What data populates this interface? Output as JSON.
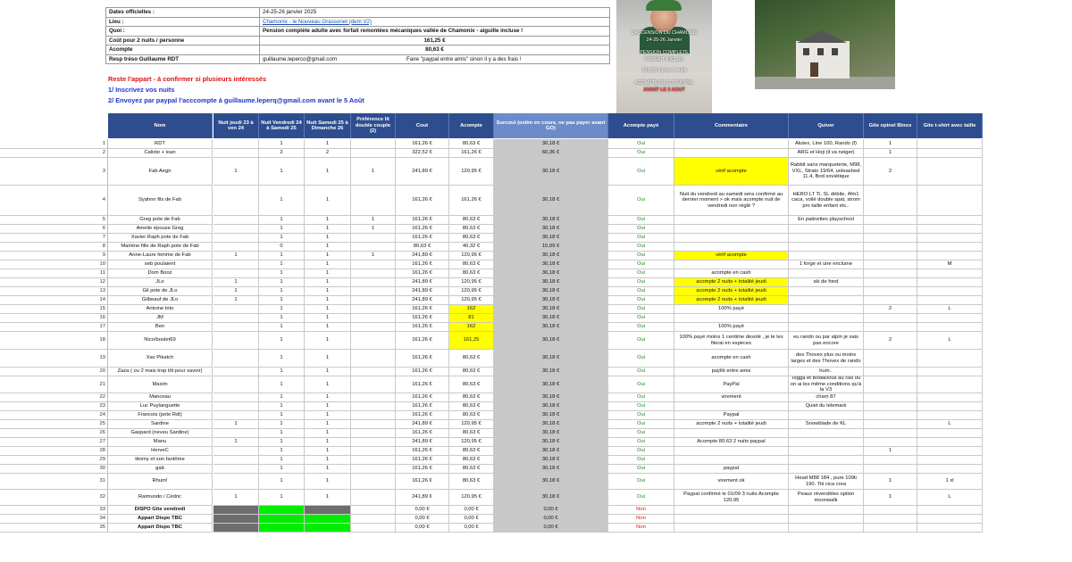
{
  "info": [
    {
      "key": "Dates officielles :",
      "value": "24-25-26 janvier 2025",
      "link": false
    },
    {
      "key": "Lieu :",
      "value": "Chamonix - le Nouveau Grassonet (dem V2)",
      "link": true
    },
    {
      "key": "Quoi :",
      "value": "Pension complète adulte avec forfait remontées mécaniques vallée de Chamonix - aiguille incluse !",
      "bold": true
    },
    {
      "key": "Coût pour 2 nuits / personne",
      "value": "161,25 €",
      "bold": true,
      "center": true
    },
    {
      "key": "Acompte",
      "value": "80,63 €",
      "bold": true,
      "center": true
    },
    {
      "key": "Resp tréso Guillaume RDT",
      "value": "guillaume.leperco@gmail.com",
      "extra": "Faire \"paypal entre amis\" sinon il y a des frais !"
    }
  ],
  "notes": [
    "Reste l'appart - à confirmer si plusieurs intéressés",
    "1/ Inscrivez vos nuits",
    "2/ Envoyez par paypal l'acccompte à guillaume.leperq@gmail.com avant le 5 Août"
  ],
  "poster_lines": [
    {
      "text": "L'ASCENSION DU CHAMONIX",
      "hl": false
    },
    {
      "text": "24-25-26 Janvier",
      "hl": false
    },
    {
      "text": "PENSION COMPLETE",
      "hl": false
    },
    {
      "text": "FORFAIT INCLUS",
      "hl": false
    },
    {
      "text": "161,25 € pour 2 nuits",
      "hl": false
    },
    {
      "text": "ACOMPTE 80,63 € PAYPAL",
      "hl": false
    },
    {
      "text": "AVANT LE 5 AOUT",
      "hl": true
    }
  ],
  "columns": [
    "",
    "Nom",
    "Nuit jeudi 23 à ven 24",
    "Nuit Vendredi 24 à Samedi 25",
    "Nuit Samedi 25 à Dimanche 26",
    "Préférence lit double couple (2)",
    "Cout",
    "Acompte",
    "Surcout (estim en cours, ne pas payer avant GO)",
    "Acompte payé",
    "Commentaire",
    "Quiver",
    "Gite opinel Binox",
    "Gite t-shirt avec taille"
  ],
  "rows": [
    {
      "n": "1",
      "nom": "RDT",
      "j": "",
      "v": "1",
      "s": "1",
      "p": "",
      "cout": "161,26 €",
      "ac": "80,63 €",
      "sur": "30,18 €",
      "paye": "Oui",
      "com": "",
      "q": "Alutex, Line 100, Rando (f)",
      "o": "1",
      "t": ""
    },
    {
      "n": "2",
      "nom": "Calixte + ioan",
      "j": "",
      "v": "2",
      "s": "2",
      "p": "",
      "cout": "322,52 €",
      "ac": "161,26 €",
      "sur": "60,36 €",
      "paye": "Oui",
      "com": "",
      "q": "ARG et Hoji (il va neiger)",
      "o": "1",
      "t": ""
    },
    {
      "n": "3",
      "nom": "Fab Aegir",
      "j": "1",
      "v": "1",
      "s": "1",
      "p": "1",
      "cout": "241,89 €",
      "ac": "120,95 €",
      "sur": "30,18 €",
      "paye": "Oui",
      "com": "vérif acompte",
      "comYel": true,
      "q": "Rabbit sans marqueterie, M98, VXL, Strato 19/64, unleashed 11.4, Bod soviétique",
      "o": "2",
      "t": ""
    },
    {
      "n": "4",
      "nom": "Syahnn fils de Fab",
      "j": "",
      "v": "1",
      "s": "1",
      "p": "",
      "cout": "161,26 €",
      "ac": "161,26 €",
      "sur": "30,18 €",
      "paye": "Oui",
      "com": "Nuit du vendredi au samedi sera confirmé au dernier moment > ok mais acompte nuit de vendredi non réglé ?",
      "q": "HERO LT Ti, SL débile, 4fm1 caca, voilé double spat, strom pro taille enfant etc..",
      "o": "",
      "t": ""
    },
    {
      "n": "5",
      "nom": "Greg pote de Fab",
      "j": "",
      "v": "1",
      "s": "1",
      "p": "1",
      "cout": "161,26 €",
      "ac": "80,63 €",
      "sur": "30,18 €",
      "paye": "Oui",
      "com": "",
      "q": "En patinettes playschool",
      "o": "",
      "t": ""
    },
    {
      "n": "6",
      "nom": "Amelie épouse Greg",
      "j": "",
      "v": "1",
      "s": "1",
      "p": "1",
      "cout": "161,26 €",
      "ac": "80,63 €",
      "sur": "30,18 €",
      "paye": "Oui",
      "com": "",
      "q": "",
      "o": "",
      "t": ""
    },
    {
      "n": "7",
      "nom": "Xavier Raph pote de Fab",
      "j": "",
      "v": "1",
      "s": "1",
      "p": "",
      "cout": "161,26 €",
      "ac": "80,63 €",
      "sur": "30,18 €",
      "paye": "Oui",
      "com": "",
      "q": "",
      "o": "",
      "t": ""
    },
    {
      "n": "8",
      "nom": "Marlène fille de Raph pote de Fab",
      "j": "",
      "v": "0",
      "s": "1",
      "p": "",
      "cout": "80,63 €",
      "ac": "40,32 €",
      "sur": "15,09 €",
      "paye": "Oui",
      "com": "",
      "q": "",
      "o": "",
      "t": ""
    },
    {
      "n": "9",
      "nom": "Anne-Laure femme de Fab",
      "j": "1",
      "v": "1",
      "s": "1",
      "p": "1",
      "cout": "241,89 €",
      "ac": "120,95 €",
      "sur": "30,18 €",
      "paye": "Oui",
      "com": "vérif acompte",
      "comYel": true,
      "q": "",
      "o": "",
      "t": ""
    },
    {
      "n": "10",
      "nom": "seb poulaient",
      "j": "",
      "v": "1",
      "s": "1",
      "p": "",
      "cout": "161,26 €",
      "ac": "80,63 €",
      "sur": "30,18 €",
      "paye": "Oui",
      "com": "",
      "q": "1 forge et une enclume",
      "o": "",
      "t": "M"
    },
    {
      "n": "11",
      "nom": "Dom Booz",
      "j": "",
      "v": "1",
      "s": "1",
      "p": "",
      "cout": "161,26 €",
      "ac": "80,63 €",
      "sur": "30,18 €",
      "paye": "Oui",
      "com": "acompte en cash",
      "q": "",
      "o": "",
      "t": ""
    },
    {
      "n": "12",
      "nom": "JLo",
      "j": "1",
      "v": "1",
      "s": "1",
      "p": "",
      "cout": "241,89 €",
      "ac": "120,95 €",
      "sur": "30,18 €",
      "paye": "Oui",
      "com": "acompte 2 nuits + totalité jeudi",
      "comYel": true,
      "q": "ski de fond",
      "o": "",
      "t": ""
    },
    {
      "n": "13",
      "nom": "Gil pote de JLo",
      "j": "1",
      "v": "1",
      "s": "1",
      "p": "",
      "cout": "241,89 €",
      "ac": "120,95 €",
      "sur": "30,18 €",
      "paye": "Oui",
      "com": "acompte 2 nuits + totalité jeudi",
      "comYel": true,
      "q": "",
      "o": "",
      "t": ""
    },
    {
      "n": "14",
      "nom": "Gilbeauf de JLo",
      "j": "1",
      "v": "1",
      "s": "1",
      "p": "",
      "cout": "241,89 €",
      "ac": "120,95 €",
      "sur": "30,18 €",
      "paye": "Oui",
      "com": "acompte 2 nuits + totalité jeudi",
      "comYel": true,
      "q": "",
      "o": "",
      "t": ""
    },
    {
      "n": "15",
      "nom": "Antoine toto",
      "j": "",
      "v": "1",
      "s": "1",
      "p": "",
      "cout": "161,26 €",
      "ac": "162",
      "acYel": true,
      "sur": "30,18 €",
      "paye": "Oui",
      "com": "100% payé",
      "q": "",
      "o": "2",
      "t": "L"
    },
    {
      "n": "16",
      "nom": "JM",
      "j": "",
      "v": "1",
      "s": "1",
      "p": "",
      "cout": "161,26 €",
      "ac": "81",
      "acYel": true,
      "sur": "30,18 €",
      "paye": "Oui",
      "com": "",
      "q": "",
      "o": "",
      "t": ""
    },
    {
      "n": "17",
      "nom": "Ben",
      "j": "",
      "v": "1",
      "s": "1",
      "p": "",
      "cout": "161,26 €",
      "ac": "162",
      "acYel": true,
      "sur": "30,18 €",
      "paye": "Oui",
      "com": "100% payé",
      "q": "",
      "o": "",
      "t": ""
    },
    {
      "n": "18",
      "nom": "Nico/boulet69",
      "j": "",
      "v": "1",
      "s": "1",
      "p": "",
      "cout": "161,26 €",
      "ac": "161,25",
      "acYel": true,
      "sur": "30,18 €",
      "paye": "Oui",
      "com": "100% payé moins 1 centime desolé , je te les filerai en espèces",
      "q": "eu rando ou par alpin je sais pas encore",
      "o": "2",
      "t": "L"
    },
    {
      "n": "19",
      "nom": "Xav Pikatch",
      "j": "",
      "v": "1",
      "s": "1",
      "p": "",
      "cout": "161,26 €",
      "ac": "80,63 €",
      "sur": "30,18 €",
      "paye": "Oui",
      "com": "acompte en cash",
      "q": "des Thovex plus ou moins larges et des Thovex de rando",
      "o": "",
      "t": ""
    },
    {
      "n": "20",
      "nom": "Zaza ( ou 2 mais trop tôt pour savoir)",
      "j": "",
      "v": "1",
      "s": "1",
      "p": "",
      "cout": "161,26 €",
      "ac": "80,63 €",
      "sur": "30,18 €",
      "paye": "Oui",
      "com": "paylib entre amis",
      "q": "hum..",
      "o": "",
      "t": ""
    },
    {
      "n": "21",
      "nom": "Maxim",
      "j": "",
      "v": "1",
      "s": "1",
      "p": "",
      "cout": "161,26 €",
      "ac": "80,63 €",
      "sur": "30,18 €",
      "paye": "Oui",
      "com": "PayPal",
      "q": "Togga et Bodacious au cas où on ai les même conditions qu'à la V3",
      "o": "",
      "t": ""
    },
    {
      "n": "22",
      "nom": "Manceau",
      "j": "",
      "v": "1",
      "s": "1",
      "p": "",
      "cout": "161,26 €",
      "ac": "80,63 €",
      "sur": "30,18 €",
      "paye": "Oui",
      "com": "virement",
      "q": "cham 87",
      "o": "",
      "t": ""
    },
    {
      "n": "23",
      "nom": "Luc Puylanguette",
      "j": "",
      "v": "1",
      "s": "1",
      "p": "",
      "cout": "161,26 €",
      "ac": "80,63 €",
      "sur": "30,18 €",
      "paye": "Oui",
      "com": "",
      "q": "Quiet du telemark",
      "o": "",
      "t": ""
    },
    {
      "n": "24",
      "nom": "Francois (pote Rdt)",
      "j": "",
      "v": "1",
      "s": "1",
      "p": "",
      "cout": "161,26 €",
      "ac": "80,63 €",
      "sur": "30,18 €",
      "paye": "Oui",
      "com": "Paypal",
      "q": "",
      "o": "",
      "t": ""
    },
    {
      "n": "25",
      "nom": "Sardine",
      "j": "1",
      "v": "1",
      "s": "1",
      "p": "",
      "cout": "241,89 €",
      "ac": "120,95 €",
      "sur": "30,18 €",
      "paye": "Oui",
      "com": "acompte 2 nuits + totalité jeudi",
      "q": "Snowblade de KL",
      "o": "",
      "t": "L"
    },
    {
      "n": "26",
      "nom": "Gaspard (neveu Sardine)",
      "j": "",
      "v": "1",
      "s": "1",
      "p": "",
      "cout": "161,26 €",
      "ac": "80,63 €",
      "sur": "30,18 €",
      "paye": "Oui",
      "com": "",
      "q": "",
      "o": "",
      "t": ""
    },
    {
      "n": "27",
      "nom": "Manu",
      "j": "1",
      "v": "1",
      "s": "1",
      "p": "",
      "cout": "241,89 €",
      "ac": "120,95 €",
      "sur": "30,18 €",
      "paye": "Oui",
      "com": "Acompte 80.63 2 nuits paypal",
      "q": "",
      "o": "",
      "t": ""
    },
    {
      "n": "28",
      "nom": "HerveC",
      "j": "",
      "v": "1",
      "s": "1",
      "p": "",
      "cout": "161,26 €",
      "ac": "80,63 €",
      "sur": "30,18 €",
      "paye": "Oui",
      "com": "",
      "q": "",
      "o": "1",
      "t": ""
    },
    {
      "n": "29",
      "nom": "titomy et son fantôme",
      "j": "",
      "v": "1",
      "s": "1",
      "p": "",
      "cout": "161,26 €",
      "ac": "80,63 €",
      "sur": "30,18 €",
      "paye": "Oui",
      "com": "",
      "q": "",
      "o": "",
      "t": ""
    },
    {
      "n": "30",
      "nom": "gab",
      "j": "",
      "v": "1",
      "s": "1",
      "p": "",
      "cout": "161,26 €",
      "ac": "80,63 €",
      "sur": "30,18 €",
      "paye": "Oui",
      "com": "paypal",
      "q": "",
      "o": "",
      "t": ""
    },
    {
      "n": "31",
      "nom": "Rhum!",
      "j": "",
      "v": "1",
      "s": "1",
      "p": "",
      "cout": "161,26 €",
      "ac": "80,63 €",
      "sur": "30,18 €",
      "paye": "Oui",
      "com": "virement ok",
      "q": "Head M88 184 , pure 109ti 190. Titi cica crea",
      "o": "1",
      "t": "1 xl"
    },
    {
      "n": "32",
      "nom": "Raimundo / Cédric",
      "j": "1",
      "v": "1",
      "s": "1",
      "p": "",
      "cout": "241,89 €",
      "ac": "120,95 €",
      "sur": "30,18 €",
      "paye": "Oui",
      "com": "Paypal confirmé le 01/09 3 nuits Acompte 120,95",
      "q": "Peaux réversibles option moonwalk",
      "o": "1",
      "t": "L"
    },
    {
      "n": "33",
      "nom": "DISPO Gîte vendredi",
      "bold": true,
      "j": "",
      "jDk": true,
      "v": "",
      "vGrn": true,
      "s": "",
      "sDk": true,
      "p": "",
      "cout": "0,00 €",
      "ac": "0,00 €",
      "sur": "0,00 €",
      "paye": "Non",
      "com": "",
      "q": "",
      "o": "",
      "t": ""
    },
    {
      "n": "34",
      "nom": "Appart Dispo TBC",
      "bold": true,
      "j": "",
      "jDk": true,
      "v": "",
      "vGrn": true,
      "s": "",
      "sGrn": true,
      "p": "",
      "cout": "0,00 €",
      "ac": "0,00 €",
      "sur": "0,00 €",
      "paye": "Non",
      "com": "",
      "q": "",
      "o": "",
      "t": ""
    },
    {
      "n": "35",
      "nom": "Appart Dispo TBC",
      "bold": true,
      "j": "",
      "jDk": true,
      "v": "",
      "vGrn": true,
      "s": "",
      "sGrn": true,
      "p": "",
      "cout": "0,00 €",
      "ac": "0,00 €",
      "sur": "0,00 €",
      "paye": "Non",
      "com": "",
      "q": "",
      "o": "",
      "t": ""
    }
  ]
}
